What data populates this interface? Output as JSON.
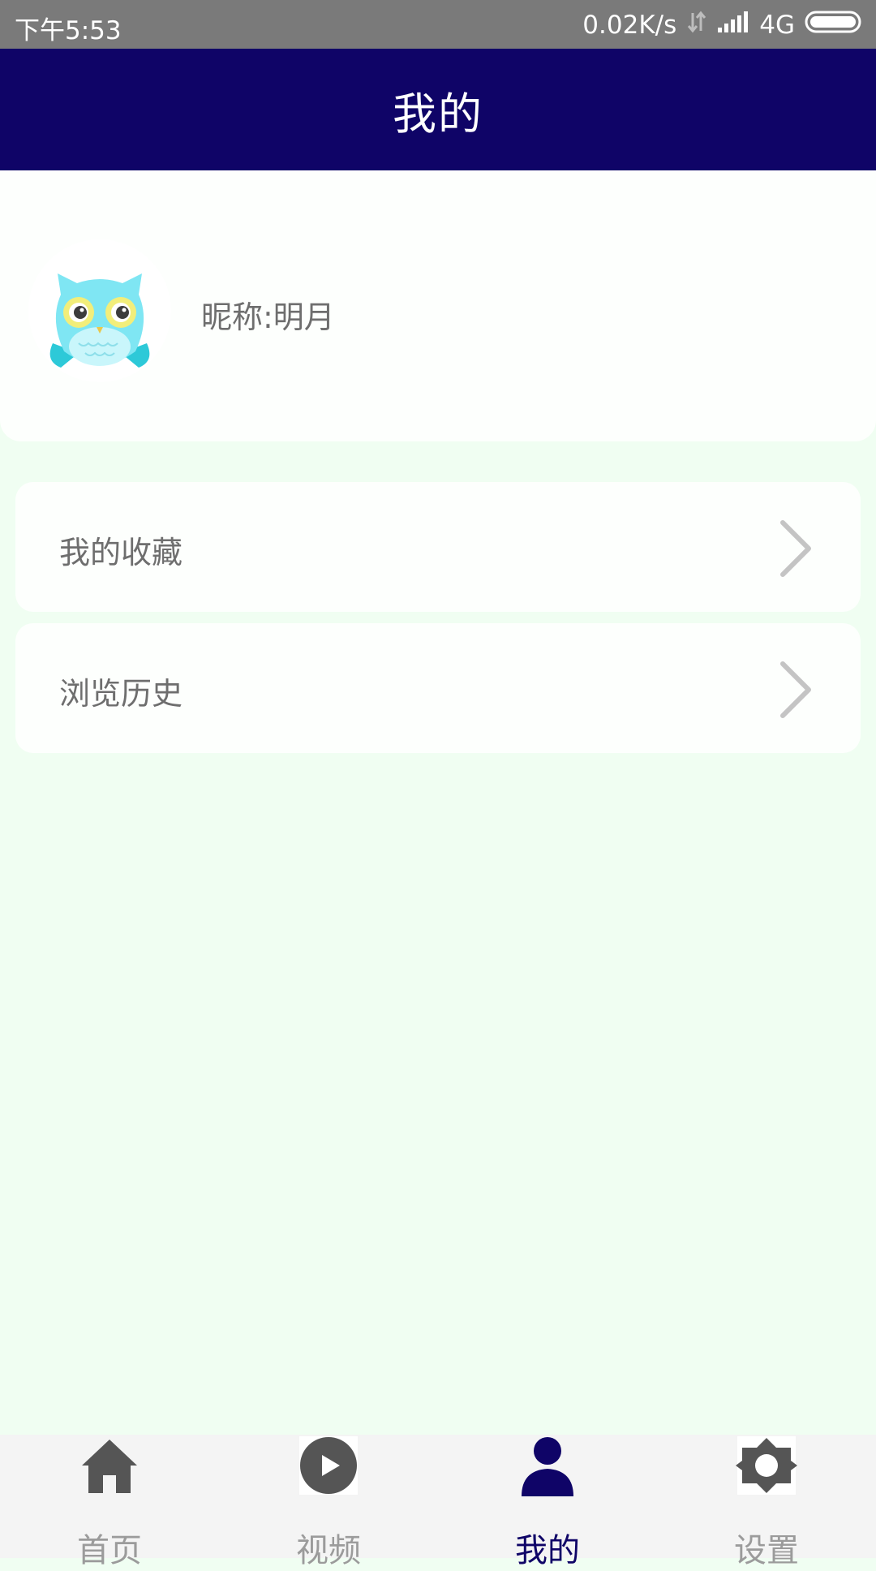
{
  "status_bar": {
    "time": "下午5:53",
    "net_speed": "0.02K/s",
    "network_type": "4G",
    "icons": [
      "data-arrows-icon",
      "signal-icon",
      "battery-icon"
    ]
  },
  "header": {
    "title": "我的"
  },
  "profile": {
    "avatar_icon": "owl-avatar-icon",
    "nickname": "昵称:明月"
  },
  "menu": {
    "items": [
      {
        "label": "我的收藏",
        "icon": "chevron-right-icon"
      },
      {
        "label": "浏览历史",
        "icon": "chevron-right-icon"
      }
    ]
  },
  "bottom_nav": {
    "items": [
      {
        "label": "首页",
        "icon": "home-icon",
        "active": false
      },
      {
        "label": "视频",
        "icon": "play-icon",
        "active": false
      },
      {
        "label": "我的",
        "icon": "user-icon",
        "active": true
      },
      {
        "label": "设置",
        "icon": "gear-icon",
        "active": false
      }
    ]
  },
  "colors": {
    "header_bg": "#0F0467",
    "status_bar_bg": "#7A7A7A",
    "page_bg": "#F0FEF2",
    "active_tab": "#0F0467",
    "inactive_tab": "#9B9B9B"
  }
}
